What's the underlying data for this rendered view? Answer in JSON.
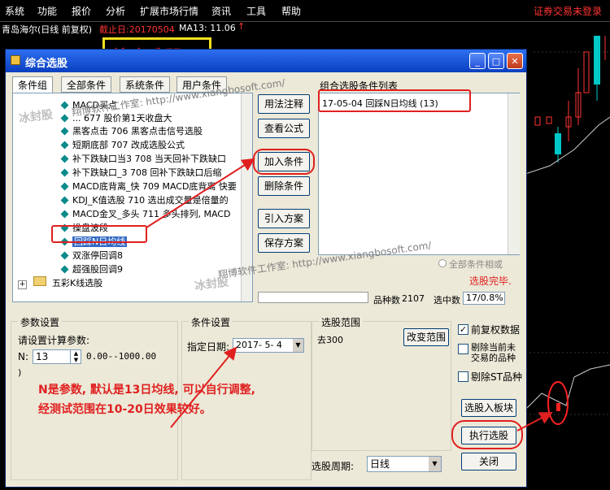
{
  "menu": [
    "系统",
    "功能",
    "报价",
    "分析",
    "扩展市场行情",
    "资讯",
    "工具",
    "帮助"
  ],
  "trade_status": "证券交易未登录",
  "chart_header": {
    "stock": "青岛海尔(日线 前复权)",
    "cutoff": "截止日:20170504",
    "ma": "MA13: 11.06",
    "arrow": "↑"
  },
  "banner": "综合选股",
  "dialog": {
    "title": "综合选股",
    "tabs": [
      "条件组",
      "全部条件",
      "系统条件",
      "用户条件"
    ],
    "tree": [
      "MACD买点",
      "...  677  股价第1天收盘大",
      "黑客点击  706  黑客点击信号选股",
      "短期底部  707  改成选股公式",
      "补下跌缺口当3  708  当天回补下跌缺口",
      "补下跌缺口_3  708  回补下跌缺口后缩",
      "MACD底背离_快  709  MACD底背离  快要",
      "KDJ_K值选股  710  选出成交量是倍量的",
      "MACD金叉_多头  711  多头排列, MACD",
      "操盘波段",
      "回踩N日均线",
      "双涨停回调8",
      "超强股回调9"
    ],
    "tree_group": "五彩K线选股",
    "mid_buttons": [
      "用法注释",
      "查看公式",
      "加入条件",
      "删除条件",
      "引入方案",
      "保存方案"
    ],
    "list_title": "组合选股条件列表",
    "list_items": [
      "17-05-04  回踩N日均线  (13)"
    ],
    "all_match_label": "全部条件相或",
    "done_text": "选股完毕.",
    "count_label": "品种数",
    "count_value": "2107",
    "selected_label": "选中数",
    "selected_value": "17/0.8%",
    "params": {
      "group_title": "参数设置",
      "prompt": "请设置计算参数:",
      "name": "N:",
      "value": "13",
      "range": "0.00--1000.00",
      "extra": ")"
    },
    "condition": {
      "group_title": "条件设置",
      "date_label": "指定日期:",
      "date_value": "2017- 5- 4"
    },
    "scope": {
      "group_title": "选股范围",
      "item": "去300",
      "change_btn": "改变范围"
    },
    "options": [
      {
        "label": "前复权数据",
        "checked": true
      },
      {
        "label": "剔除当前未交易的品种",
        "checked": false
      },
      {
        "label": "剔除ST品种",
        "checked": false
      }
    ],
    "btn_to_block": "选股入板块",
    "btn_run": "执行选股",
    "btn_close": "关闭",
    "period_label": "选股周期:",
    "period_value": "日线"
  },
  "annotation": {
    "line1": "N是参数, 默认是13日均线, 可以自行调整,",
    "line2": "经测试范围在10-20日效果较好。"
  },
  "watermarks": {
    "site": "翔博软件工作室: http://www.xiangbosoft.com/",
    "seal": "冰封股"
  },
  "colors": {
    "accent_red": "#e02020",
    "title_blue": "#0a3fc0",
    "chart_cyan": "#00c8c8"
  }
}
